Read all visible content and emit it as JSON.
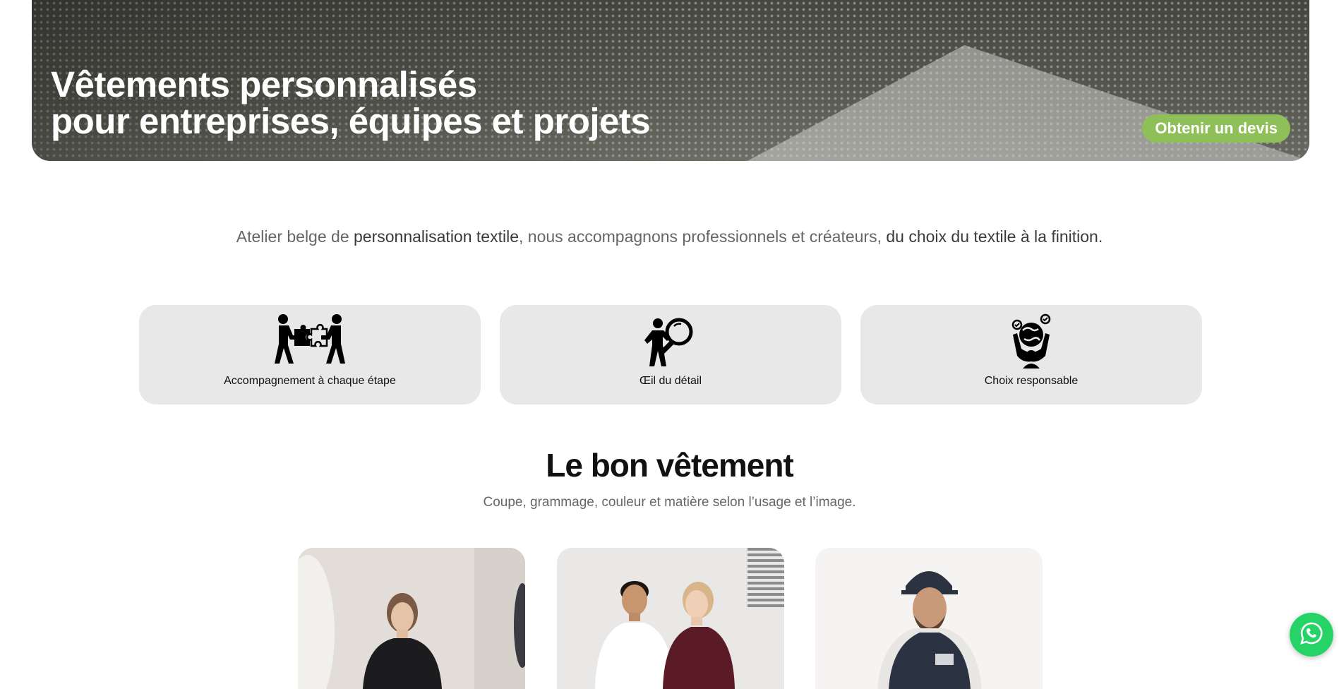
{
  "hero": {
    "title_line1": "Vêtements personnalisés",
    "title_line2": "pour entreprises, équipes et projets",
    "cta_label": "Obtenir un devis",
    "cta_color": "#8fbf59"
  },
  "intro": {
    "part1": "Atelier belge de ",
    "strong1": "personnalisation textile",
    "part2": ", nous accompagnons professionnels et créateurs, ",
    "strong2": "du choix du textile à la finition."
  },
  "features": [
    {
      "icon": "puzzle-people-icon",
      "label": "Accompagnement à chaque étape"
    },
    {
      "icon": "magnifier-person-icon",
      "label": "Œil du détail"
    },
    {
      "icon": "hands-globe-icon",
      "label": "Choix responsable"
    }
  ],
  "section": {
    "title": "Le bon vêtement",
    "subtitle": "Coupe, grammage, couleur et matière selon l’usage et l’image."
  },
  "products": [
    {
      "image": "model-black-sweatshirt-photo"
    },
    {
      "image": "couple-polo-shirts-photo"
    },
    {
      "image": "man-cap-bodywarmer-photo"
    }
  ],
  "whatsapp": {
    "icon": "whatsapp-icon",
    "color": "#25d366"
  }
}
